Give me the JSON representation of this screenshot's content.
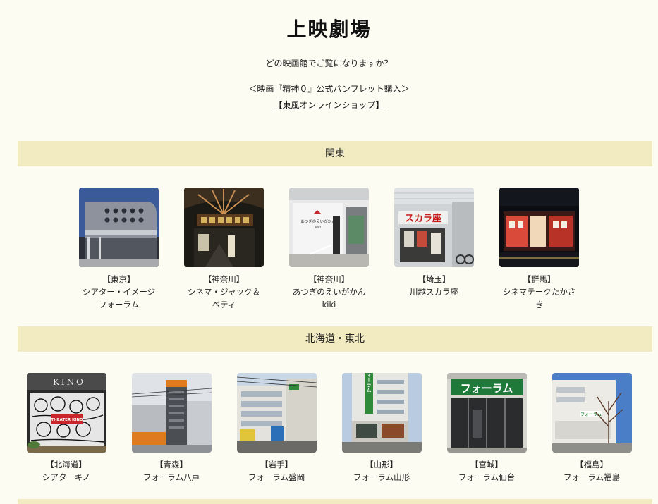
{
  "header": {
    "title": "上映劇場",
    "question": "どの映画館でご覧になりますか？",
    "pamphlet": "＜映画『精神０』公式パンフレット購入＞",
    "shop_link": "【東風オンラインショップ】"
  },
  "sections": [
    {
      "title": "関東",
      "theaters": [
        {
          "pref": "【東京】",
          "name": "シアター・イメージフォーラム"
        },
        {
          "pref": "【神奈川】",
          "name": "シネマ・ジャック＆ベティ"
        },
        {
          "pref": "【神奈川】",
          "name": "あつぎのえいがかんkiki"
        },
        {
          "pref": "【埼玉】",
          "name": "川越スカラ座"
        },
        {
          "pref": "【群馬】",
          "name": "シネマテークたかさき"
        }
      ]
    },
    {
      "title": "北海道・東北",
      "theaters": [
        {
          "pref": "【北海道】",
          "name": "シアターキノ"
        },
        {
          "pref": "【青森】",
          "name": "フォーラム八戸"
        },
        {
          "pref": "【岩手】",
          "name": "フォーラム盛岡"
        },
        {
          "pref": "【山形】",
          "name": "フォーラム山形"
        },
        {
          "pref": "【宮城】",
          "name": "フォーラム仙台"
        },
        {
          "pref": "【福島】",
          "name": "フォーラム福島"
        }
      ]
    }
  ],
  "photo_signage": {
    "kino": "KINO",
    "kino_poster": "THEATER KINO",
    "atsugi": "あつぎのえいがかん",
    "atsugi_sub": "kiki",
    "scala": "スカラ座",
    "forum": "フォーラム",
    "forum_vertical": "フォーラム"
  }
}
